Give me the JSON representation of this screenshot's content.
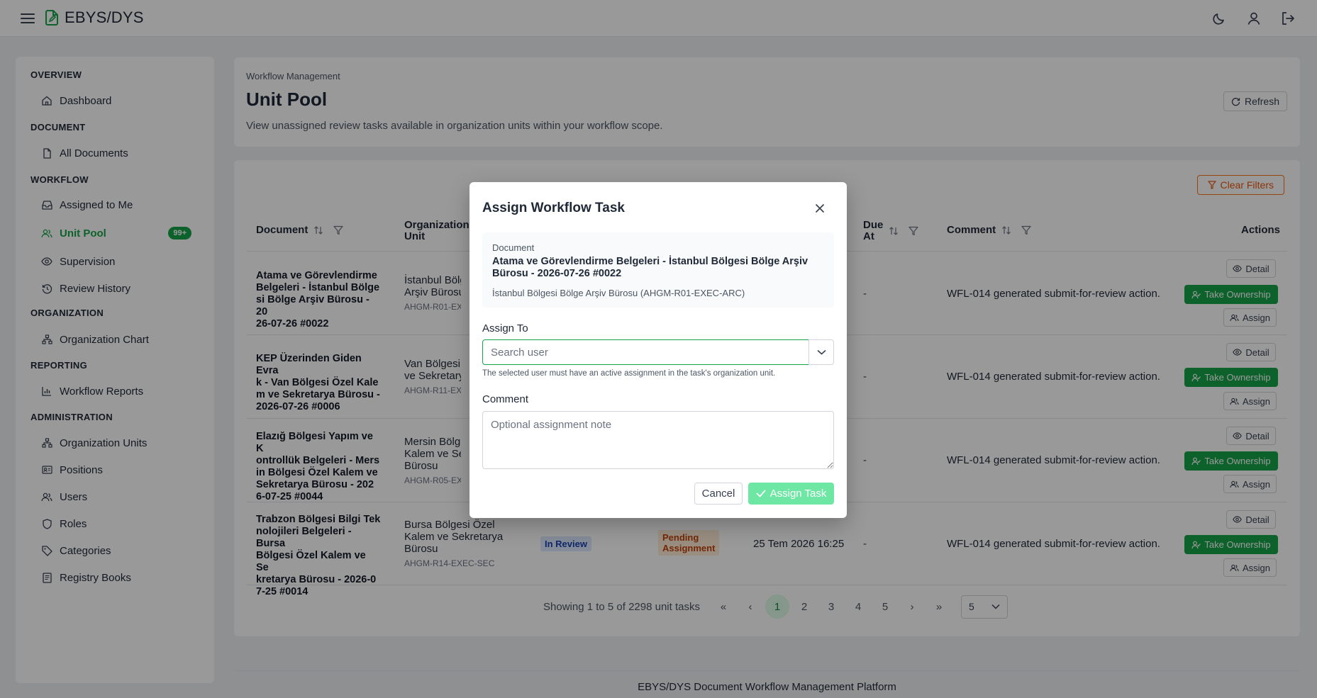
{
  "app": {
    "brand": "EBYS/DYS"
  },
  "sidebar": {
    "sections": [
      {
        "title": "OVERVIEW",
        "items": [
          {
            "label": "Dashboard",
            "icon": "home-icon"
          }
        ]
      },
      {
        "title": "DOCUMENT",
        "items": [
          {
            "label": "All Documents",
            "icon": "file-icon"
          }
        ]
      },
      {
        "title": "WORKFLOW",
        "items": [
          {
            "label": "Assigned to Me",
            "icon": "inbox-icon"
          },
          {
            "label": "Unit Pool",
            "icon": "users-icon",
            "badge": "99+",
            "active": true
          },
          {
            "label": "Supervision",
            "icon": "eye-icon"
          },
          {
            "label": "Review History",
            "icon": "history-icon"
          }
        ]
      },
      {
        "title": "ORGANIZATION",
        "items": [
          {
            "label": "Organization Chart",
            "icon": "sitemap-icon"
          }
        ]
      },
      {
        "title": "REPORTING",
        "items": [
          {
            "label": "Workflow Reports",
            "icon": "chart-icon"
          }
        ]
      },
      {
        "title": "ADMINISTRATION",
        "items": [
          {
            "label": "Organization Units",
            "icon": "sitemap-icon"
          },
          {
            "label": "Positions",
            "icon": "id-card-icon"
          },
          {
            "label": "Users",
            "icon": "users-icon"
          },
          {
            "label": "Roles",
            "icon": "shield-icon"
          },
          {
            "label": "Categories",
            "icon": "tag-icon"
          },
          {
            "label": "Registry Books",
            "icon": "book-icon"
          }
        ]
      }
    ]
  },
  "header": {
    "breadcrumb": "Workflow Management",
    "title": "Unit Pool",
    "description": "View unassigned review tasks available in organization units within your workflow scope.",
    "refresh_label": "Refresh"
  },
  "table": {
    "clear_filters_label": "Clear Filters",
    "columns": {
      "document": "Document",
      "org_unit_line1": "Organization",
      "org_unit_line2": "Unit",
      "due_line1": "Due",
      "due_line2": "At",
      "comment": "Comment",
      "actions": "Actions"
    },
    "rows": [
      {
        "document_lines": [
          "Atama ve Görevlendirme",
          "Belgeleri - İstanbul Bölge",
          "si Bölge Arşiv Bürosu - 20",
          "26-07-26 #0022"
        ],
        "org_lines": [
          "İstanbul Bölge",
          "Arşiv Bürosu"
        ],
        "org_code": "AHGM-R01-EXEC",
        "due": "-",
        "comment": "WFL-014 generated submit-for-review action."
      },
      {
        "document_lines": [
          "KEP Üzerinden Giden Evra",
          "k - Van Bölgesi Özel Kale",
          "m ve Sekretarya Bürosu -",
          "2026-07-26 #0006"
        ],
        "org_lines": [
          "Van Bölgesi Ö",
          "ve Sekretarya"
        ],
        "org_code": "AHGM-R11-EXEC",
        "due": "-",
        "comment": "WFL-014 generated submit-for-review action."
      },
      {
        "document_lines": [
          "Elazığ Bölgesi Yapım ve K",
          "ontrollük Belgeleri - Mers",
          "in Bölgesi Özel Kalem ve",
          "Sekretarya Bürosu - 202",
          "6-07-25 #0044"
        ],
        "org_lines": [
          "Mersin Bölges",
          "Kalem ve Sekr",
          "Bürosu"
        ],
        "org_code": "AHGM-R05-EXEC",
        "due": "-",
        "comment": "WFL-014 generated submit-for-review action."
      },
      {
        "document_lines": [
          "Trabzon Bölgesi Bilgi Tek",
          "nolojileri Belgeleri - Bursa",
          "Bölgesi Özel Kalem ve Se",
          "kretarya Bürosu - 2026-0",
          "7-25 #0014"
        ],
        "org_lines": [
          "Bursa Bölgesi Özel",
          "Kalem ve Sekretarya",
          "Bürosu"
        ],
        "org_code": "AHGM-R14-EXEC-SEC",
        "status": "In Review",
        "assignment_lines": [
          "Pending",
          "Assignment"
        ],
        "created": "25 Tem 2026 16:25",
        "due": "-",
        "comment": "WFL-014 generated submit-for-review action."
      }
    ],
    "actions": {
      "detail": "Detail",
      "take_ownership": "Take Ownership",
      "assign": "Assign"
    }
  },
  "pagination": {
    "summary": "Showing 1 to 5 of 2298 unit tasks",
    "first": "«",
    "prev": "‹",
    "pages": [
      "1",
      "2",
      "3",
      "4",
      "5"
    ],
    "next": "›",
    "last": "»",
    "page_size": "5"
  },
  "footer": {
    "text": "EBYS/DYS Document Workflow Management Platform"
  },
  "modal": {
    "title": "Assign Workflow Task",
    "document_label": "Document",
    "document_name": "Atama ve Görevlendirme Belgeleri - İstanbul Bölgesi Bölge Arşiv Bürosu - 2026-07-26 #0022",
    "document_unit": "İstanbul Bölgesi Bölge Arşiv Bürosu (AHGM-R01-EXEC-ARC)",
    "assign_to_label": "Assign To",
    "assign_to_placeholder": "Search user",
    "assign_to_value": "",
    "hint": "The selected user must have an active assignment in the task's organization unit.",
    "comment_label": "Comment",
    "comment_placeholder": "Optional assignment note",
    "comment_value": "",
    "cancel_label": "Cancel",
    "submit_label": "Assign Task"
  },
  "colors": {
    "accent": "#16a34a",
    "warning": "#ea580c"
  }
}
